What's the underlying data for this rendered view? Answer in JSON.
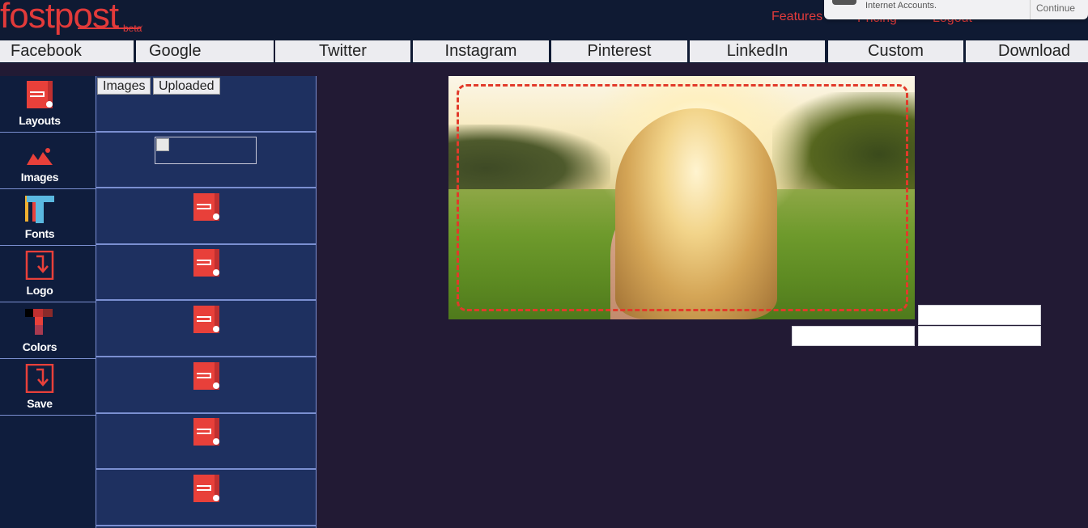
{
  "header": {
    "logo_text": "fostpost",
    "logo_badge": "beta",
    "nav": {
      "features": "Features",
      "pricing": "Pricing",
      "logout": "Logout"
    }
  },
  "notification": {
    "text": "Internet Accounts.",
    "button": "Continue"
  },
  "platform_tabs": [
    {
      "label": "Facebook"
    },
    {
      "label": "Google"
    },
    {
      "label": "Twitter"
    },
    {
      "label": "Instagram"
    },
    {
      "label": "Pinterest"
    },
    {
      "label": "LinkedIn"
    },
    {
      "label": "Custom"
    },
    {
      "label": "Download"
    }
  ],
  "toolbar": {
    "items": [
      {
        "label": "Layouts",
        "icon": "layout-icon"
      },
      {
        "label": "Images",
        "icon": "image-icon"
      },
      {
        "label": "Fonts",
        "icon": "font-icon"
      },
      {
        "label": "Logo",
        "icon": "logo-icon"
      },
      {
        "label": "Colors",
        "icon": "colors-icon"
      },
      {
        "label": "Save",
        "icon": "save-icon"
      }
    ]
  },
  "panel": {
    "subtabs": {
      "images": "Images",
      "uploaded": "Uploaded"
    }
  },
  "colors": {
    "brand_red": "#e23a3a",
    "header_bg": "#0f1a33",
    "panel_bg": "#1e3060",
    "page_bg": "#221a34",
    "divider": "#7b8fd1"
  }
}
